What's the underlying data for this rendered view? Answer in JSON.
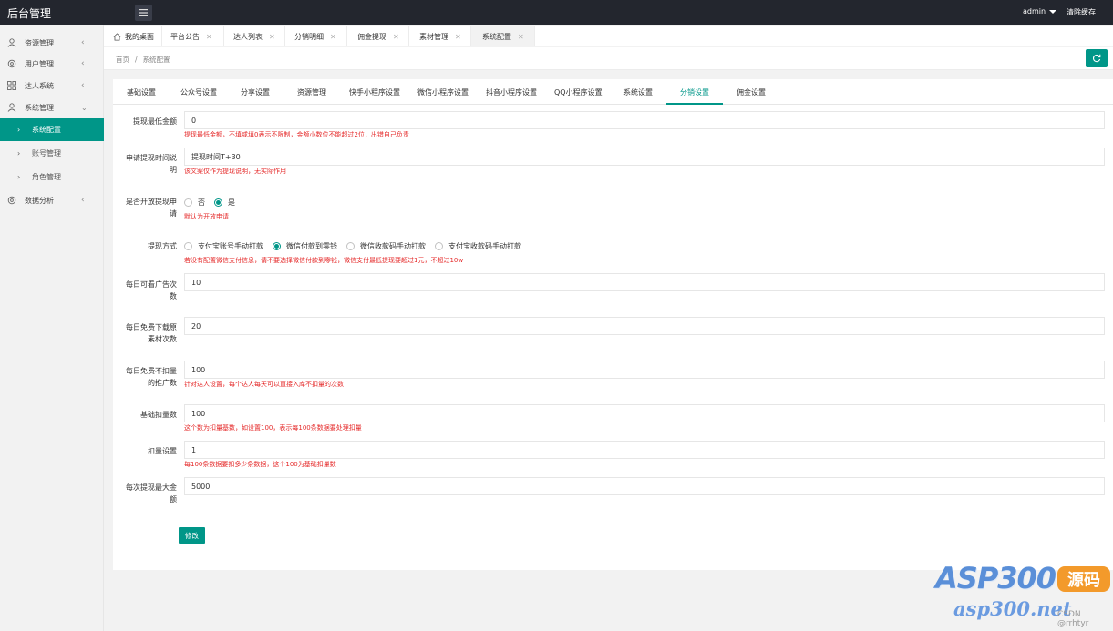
{
  "header": {
    "title": "后台管理",
    "user": "admin",
    "clear_cache": "清除缓存"
  },
  "sidebar": {
    "items": [
      {
        "label": "资源管理",
        "icon": "user-icon"
      },
      {
        "label": "用户管理",
        "icon": "settings-icon"
      },
      {
        "label": "达人系统",
        "icon": "grid-icon"
      },
      {
        "label": "系统管理",
        "icon": "user-icon"
      },
      {
        "label": "数据分析",
        "icon": "settings-icon"
      }
    ],
    "sub_items": [
      {
        "label": "系统配置"
      },
      {
        "label": "账号管理"
      },
      {
        "label": "角色管理"
      }
    ]
  },
  "tabs": [
    "我的桌面",
    "平台公告",
    "达人列表",
    "分销明细",
    "佣金提现",
    "素材管理",
    "系统配置"
  ],
  "breadcrumb": {
    "home": "首页",
    "separator": "/",
    "current": "系统配置"
  },
  "content_tabs": [
    "基础设置",
    "公众号设置",
    "分享设置",
    "资源管理",
    "快手小程序设置",
    "微信小程序设置",
    "抖音小程序设置",
    "QQ小程序设置",
    "系统设置",
    "分销设置",
    "佣金设置"
  ],
  "form": {
    "min_withdraw": {
      "label": "提现最低金额",
      "value": "0",
      "tip": "提现最低金额，不填或填0表示不限制，金额小数位不能超过2位，出错自己负责"
    },
    "withdraw_time": {
      "label": "申请提现时间说明",
      "value": "提现时间T+30",
      "tip": "该文案仅作为提现说明，无实际作用"
    },
    "open_withdraw": {
      "label": "是否开放提现申请",
      "options": [
        "否",
        "是"
      ],
      "selected": "是",
      "tip": "默认为开放申请"
    },
    "withdraw_method": {
      "label": "提现方式",
      "options": [
        "支付宝账号手动打款",
        "微信付款到零钱",
        "微信收款码手动打款",
        "支付宝收款码手动打款"
      ],
      "selected": "微信付款到零钱",
      "tip": "若没有配置微信支付信息，请不要选择微信付款到零钱，微信支付最低提现要超过1元，不超过10w"
    },
    "daily_ads": {
      "label": "每日可看广告次数",
      "value": "10"
    },
    "daily_free_downloads": {
      "label": "每日免费下载原素材次数",
      "value": "20"
    },
    "daily_free_no_deduct": {
      "label": "每日免费不扣量的推广数",
      "value": "100",
      "tip": "针对达人设置，每个达人每天可以直接入库不扣量的次数"
    },
    "base_deduct": {
      "label": "基础扣量数",
      "value": "100",
      "tip": "这个数为扣量基数，如设置100，表示每100条数据要处理扣量"
    },
    "deduct_setting": {
      "label": "扣量设置",
      "value": "1",
      "tip": "每100条数据要扣多少条数据，这个100为基础扣量数"
    },
    "max_withdraw": {
      "label": "每次提现最大金额",
      "value": "5000"
    },
    "submit": "修改"
  },
  "watermark": {
    "brand": "ASP300",
    "badge": "源码",
    "domain": "asp300.net",
    "author": "CSDN @rrhtyr"
  }
}
